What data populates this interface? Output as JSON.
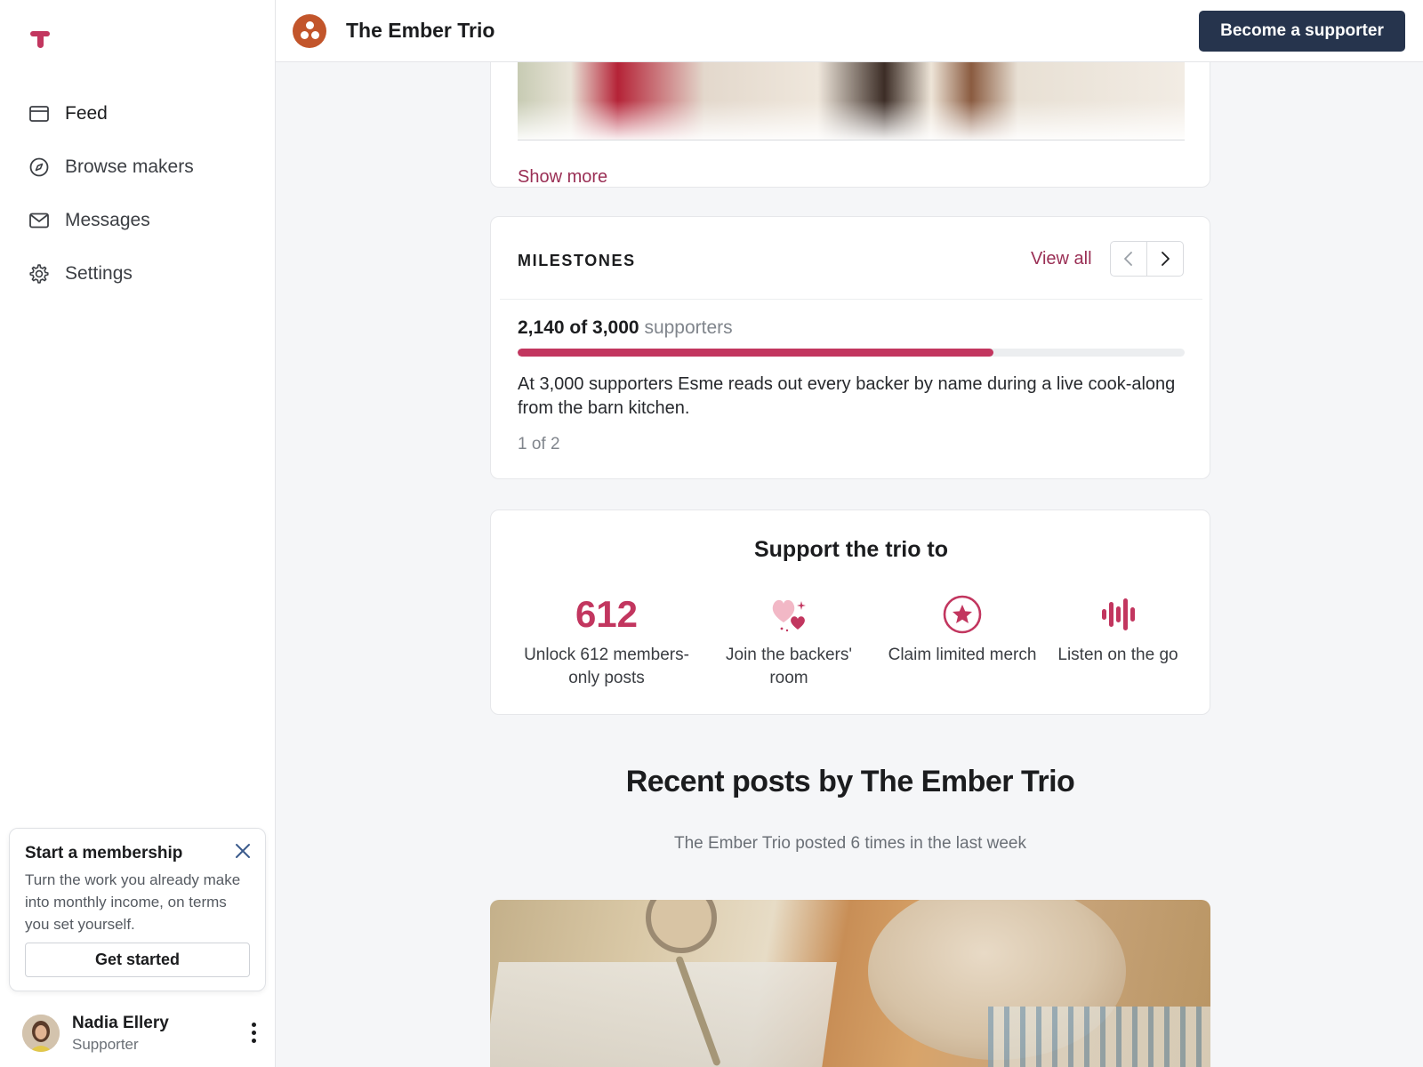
{
  "sidebar": {
    "nav": [
      {
        "label": "Feed",
        "icon": "feed-icon"
      },
      {
        "label": "Browse makers",
        "icon": "compass-icon"
      },
      {
        "label": "Messages",
        "icon": "mail-icon"
      },
      {
        "label": "Settings",
        "icon": "gear-icon"
      }
    ],
    "promo": {
      "title": "Start a membership",
      "text": "Turn the work you already make into monthly income, on terms you set yourself.",
      "button": "Get started"
    },
    "user": {
      "name": "Nadia Ellery",
      "role": "Supporter"
    }
  },
  "header": {
    "creator_name": "The Ember Trio",
    "cta": "Become a supporter"
  },
  "post_top": {
    "show_more": "Show more"
  },
  "milestones": {
    "heading": "MILESTONES",
    "view_all": "View all",
    "count_bold": "2,140 of 3,000",
    "count_suffix": "supporters",
    "progress": 0.713,
    "description": "At 3,000 supporters Esme reads out every backer by name during a live cook-along from the barn kitchen.",
    "pager": "1 of 2"
  },
  "support": {
    "title": "Support the trio to",
    "items": [
      {
        "value": "612",
        "label": "Unlock 612 members-only posts"
      },
      {
        "icon": "hearts-icon",
        "label": "Join the backers' room"
      },
      {
        "icon": "star-badge-icon",
        "label": "Claim limited merch"
      },
      {
        "icon": "audio-icon",
        "label": "Listen on the go"
      }
    ]
  },
  "recent": {
    "title": "Recent posts by The Ember Trio",
    "subtitle": "The Ember Trio posted 6 times in the last week"
  },
  "colors": {
    "accent": "#c2365f",
    "link": "#9a2f55",
    "cta": "#26344d",
    "creator_logo": "#c2552b"
  }
}
